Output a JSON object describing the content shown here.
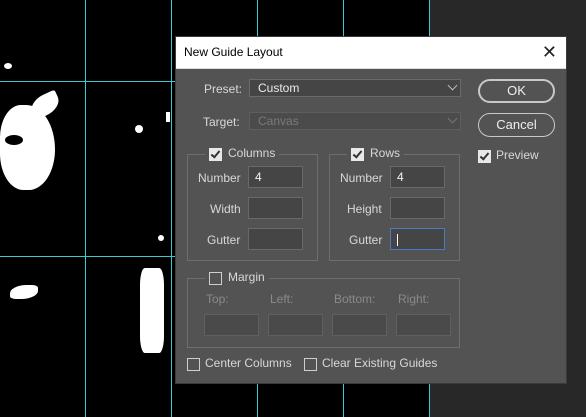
{
  "dialog": {
    "title": "New Guide Layout",
    "preset_label": "Preset:",
    "preset_value": "Custom",
    "target_label": "Target:",
    "target_value": "Canvas",
    "ok_label": "OK",
    "cancel_label": "Cancel",
    "preview_label": "Preview",
    "preview_checked": true,
    "columns": {
      "label": "Columns",
      "checked": true,
      "number_label": "Number",
      "number_value": "4",
      "width_label": "Width",
      "width_value": "",
      "gutter_label": "Gutter",
      "gutter_value": ""
    },
    "rows": {
      "label": "Rows",
      "checked": true,
      "number_label": "Number",
      "number_value": "4",
      "height_label": "Height",
      "height_value": "",
      "gutter_label": "Gutter",
      "gutter_value": ""
    },
    "margin": {
      "label": "Margin",
      "checked": false,
      "top_label": "Top:",
      "left_label": "Left:",
      "bottom_label": "Bottom:",
      "right_label": "Right:"
    },
    "center_columns_label": "Center Columns",
    "center_columns_checked": false,
    "clear_guides_label": "Clear Existing Guides",
    "clear_guides_checked": false
  },
  "colors": {
    "guide": "#3cc8d0",
    "dialog_bg": "#535353",
    "pasteboard": "#282828",
    "active_field_border": "#4a7ac5"
  }
}
